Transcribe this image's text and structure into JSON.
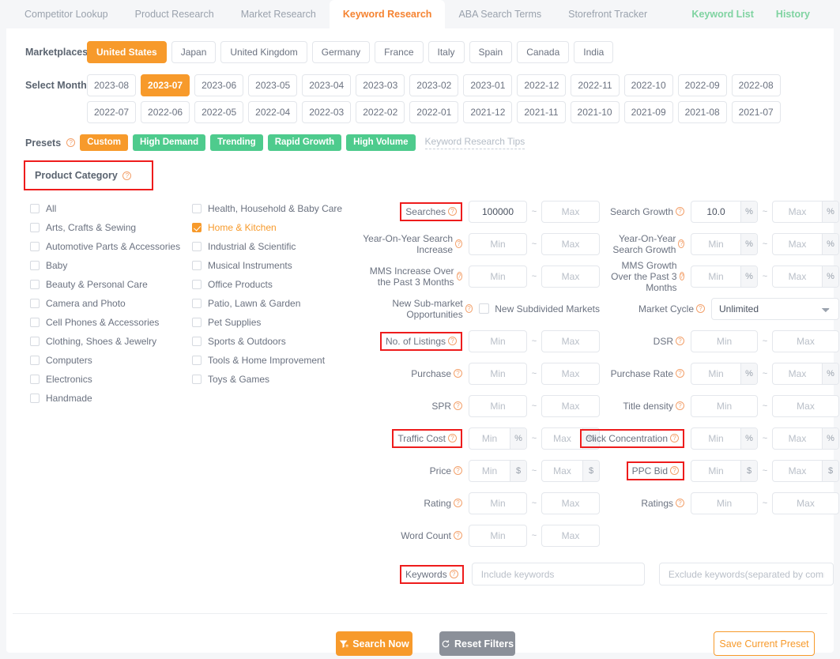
{
  "tabs": [
    {
      "label": "Competitor Lookup",
      "active": false
    },
    {
      "label": "Product Research",
      "active": false
    },
    {
      "label": "Market Research",
      "active": false
    },
    {
      "label": "Keyword Research",
      "active": true
    },
    {
      "label": "ABA Search Terms",
      "active": false
    },
    {
      "label": "Storefront Tracker",
      "active": false
    }
  ],
  "top_links": [
    {
      "label": "Keyword List"
    },
    {
      "label": "History"
    }
  ],
  "marketplaces": {
    "label": "Marketplaces",
    "items": [
      "United States",
      "Japan",
      "United Kingdom",
      "Germany",
      "France",
      "Italy",
      "Spain",
      "Canada",
      "India"
    ],
    "selected": "United States"
  },
  "select_month": {
    "label": "Select Month",
    "row1": [
      "2023-08",
      "2023-07",
      "2023-06",
      "2023-05",
      "2023-04",
      "2023-03",
      "2023-02",
      "2023-01",
      "2022-12",
      "2022-11",
      "2022-10",
      "2022-09",
      "2022-08",
      "2022-07"
    ],
    "row2": [
      "2022-06",
      "2022-05",
      "2022-04",
      "2022-03",
      "2022-02",
      "2022-01",
      "2021-12",
      "2021-11",
      "2021-10",
      "2021-09",
      "2021-08",
      "2021-07"
    ],
    "selected": "2023-07"
  },
  "presets": {
    "label": "Presets",
    "items": [
      {
        "label": "Custom",
        "style": "custom"
      },
      {
        "label": "High Demand",
        "style": "green"
      },
      {
        "label": "Trending",
        "style": "green"
      },
      {
        "label": "Rapid Growth",
        "style": "green"
      },
      {
        "label": "High Volume",
        "style": "green"
      }
    ],
    "tips_link": "Keyword Research Tips"
  },
  "product_category": {
    "header": "Product Category",
    "col1": [
      {
        "label": "All",
        "checked": false
      },
      {
        "label": "Arts, Crafts & Sewing",
        "checked": false
      },
      {
        "label": "Automotive Parts & Accessories",
        "checked": false
      },
      {
        "label": "Baby",
        "checked": false
      },
      {
        "label": "Beauty & Personal Care",
        "checked": false
      },
      {
        "label": "Camera and Photo",
        "checked": false
      },
      {
        "label": "Cell Phones & Accessories",
        "checked": false
      },
      {
        "label": "Clothing, Shoes & Jewelry",
        "checked": false
      },
      {
        "label": "Computers",
        "checked": false
      },
      {
        "label": "Electronics",
        "checked": false
      },
      {
        "label": "Handmade",
        "checked": false
      }
    ],
    "col2": [
      {
        "label": "Health, Household & Baby Care",
        "checked": false
      },
      {
        "label": "Home & Kitchen",
        "checked": true
      },
      {
        "label": "Industrial & Scientific",
        "checked": false
      },
      {
        "label": "Musical Instruments",
        "checked": false
      },
      {
        "label": "Office Products",
        "checked": false
      },
      {
        "label": "Patio, Lawn & Garden",
        "checked": false
      },
      {
        "label": "Pet Supplies",
        "checked": false
      },
      {
        "label": "Sports & Outdoors",
        "checked": false
      },
      {
        "label": "Tools & Home Improvement",
        "checked": false
      },
      {
        "label": "Toys & Games",
        "checked": false
      }
    ]
  },
  "filters_mid": {
    "searches": {
      "label": "Searches",
      "min_value": "100000",
      "min_placeholder": "Min",
      "max_value": "",
      "max_placeholder": "Max",
      "highlighted": true
    },
    "yoy_search_increase": {
      "label": "Year-On-Year Search Increase",
      "min_placeholder": "Min",
      "max_placeholder": "Max"
    },
    "mms_increase_3m": {
      "label": "MMS Increase Over the Past 3 Months",
      "min_placeholder": "Min",
      "max_placeholder": "Max"
    },
    "new_submarket": {
      "label": "New Sub-market Opportunities",
      "checkbox_label": "New Subdivided Markets",
      "checked": false
    },
    "no_of_listings": {
      "label": "No. of Listings",
      "min_placeholder": "Min",
      "max_placeholder": "Max",
      "highlighted": true
    },
    "purchase": {
      "label": "Purchase",
      "min_placeholder": "Min",
      "max_placeholder": "Max"
    },
    "spr": {
      "label": "SPR",
      "min_placeholder": "Min",
      "max_placeholder": "Max"
    },
    "traffic_cost": {
      "label": "Traffic Cost",
      "min_placeholder": "Min",
      "max_placeholder": "Max",
      "unit": "%",
      "highlighted": true
    },
    "price": {
      "label": "Price",
      "min_placeholder": "Min",
      "max_placeholder": "Max",
      "unit": "$"
    },
    "rating": {
      "label": "Rating",
      "min_placeholder": "Min",
      "max_placeholder": "Max"
    },
    "word_count": {
      "label": "Word Count",
      "min_placeholder": "Min",
      "max_placeholder": "Max"
    }
  },
  "filters_right": {
    "search_growth": {
      "label": "Search Growth",
      "min_value": "10.0",
      "min_placeholder": "Min",
      "max_placeholder": "Max",
      "unit": "%"
    },
    "yoy_search_growth": {
      "label": "Year-On-Year Search Growth",
      "min_placeholder": "Min",
      "max_placeholder": "Max",
      "unit": "%"
    },
    "mms_growth_3m": {
      "label": "MMS Growth Over the Past 3 Months",
      "min_placeholder": "Min",
      "max_placeholder": "Max",
      "unit": "%"
    },
    "market_cycle": {
      "label": "Market Cycle",
      "value": "Unlimited",
      "options": [
        "Unlimited"
      ]
    },
    "dsr": {
      "label": "DSR",
      "min_placeholder": "Min",
      "max_placeholder": "Max"
    },
    "purchase_rate": {
      "label": "Purchase Rate",
      "min_placeholder": "Min",
      "max_placeholder": "Max",
      "unit": "%"
    },
    "title_density": {
      "label": "Title density",
      "min_placeholder": "Min",
      "max_placeholder": "Max"
    },
    "click_concentration": {
      "label": "Click Concentration",
      "min_placeholder": "Min",
      "max_placeholder": "Max",
      "unit": "%",
      "highlighted": true
    },
    "ppc_bid": {
      "label": "PPC Bid",
      "min_placeholder": "Min",
      "max_placeholder": "Max",
      "unit": "$",
      "highlighted": true
    },
    "ratings": {
      "label": "Ratings",
      "min_placeholder": "Min",
      "max_placeholder": "Max"
    }
  },
  "keywords": {
    "label": "Keywords",
    "include_placeholder": "Include keywords",
    "include_value": "",
    "exclude_placeholder": "Exclude keywords(separated by commas)",
    "exclude_value": "",
    "highlighted": true
  },
  "footer": {
    "search_now": "Search Now",
    "reset_filters": "Reset Filters",
    "save_preset": "Save Current Preset"
  },
  "colors": {
    "accent_orange": "#f79a2b",
    "accent_green": "#4ecb8d",
    "annotation_red": "#ee1c1c",
    "text_gray": "#6b7280"
  }
}
